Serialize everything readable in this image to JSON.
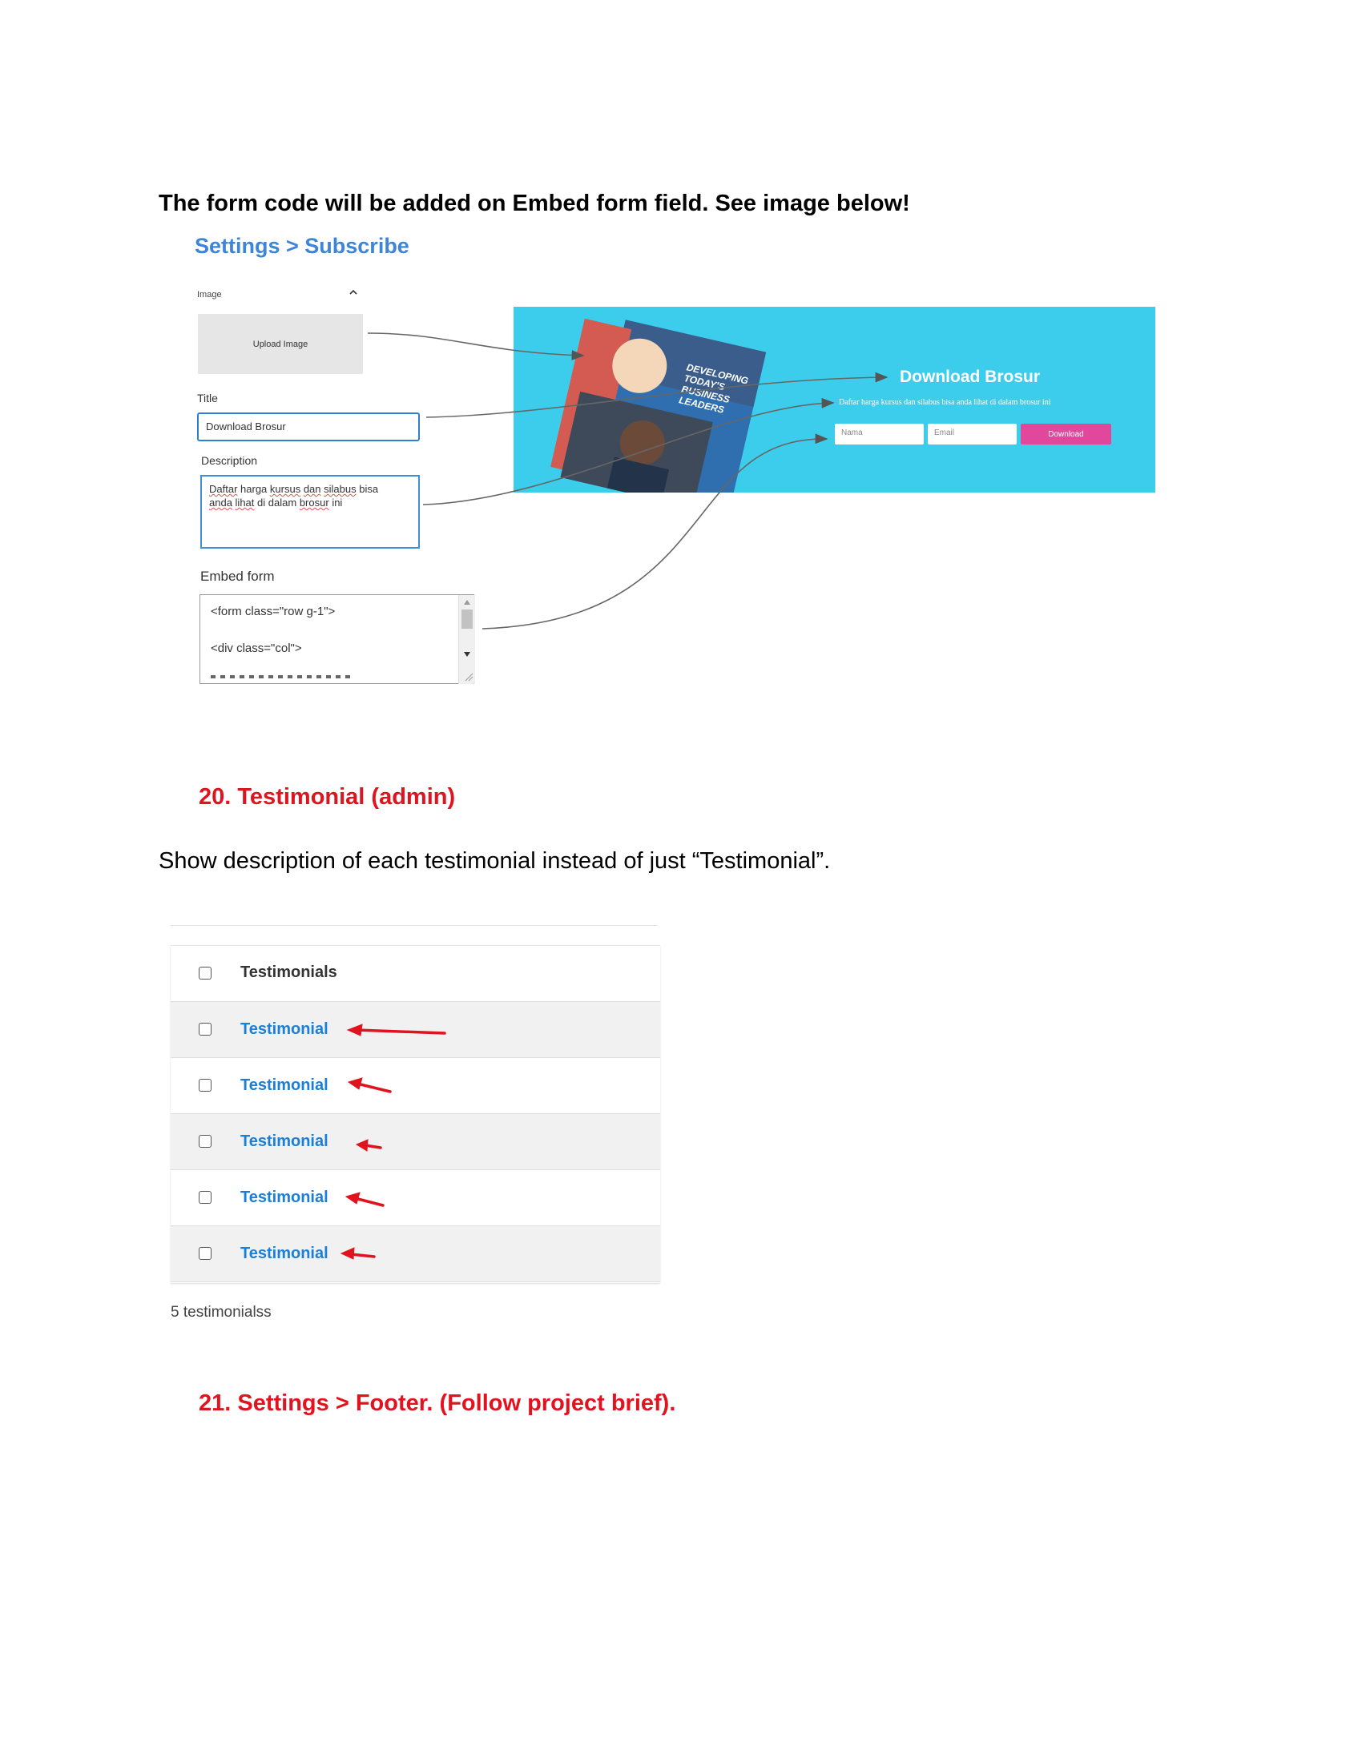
{
  "intro_text": "The form code will be added on Embed form field. See image below!",
  "settings_panel": {
    "title": "Settings > Subscribe",
    "image_label": "Image",
    "upload_button": "Upload Image",
    "title_label": "Title",
    "title_value": "Download Brosur",
    "description_label": "Description",
    "description_words": [
      "Daftar",
      "harga",
      "kursus",
      "dan",
      "silabus",
      "bisa",
      "anda",
      "lihat",
      "di",
      "dalam",
      "brosur",
      "ini"
    ],
    "embed_label": "Embed form",
    "embed_lines": [
      "<form class=\"row g-1\">",
      "<div class=\"col\">"
    ]
  },
  "preview_banner": {
    "brochure_heading": "DEVELOPING TODAY'S BUSINESS LEADERS",
    "title": "Download Brosur",
    "description": "Daftar harga kursus dan silabus bisa anda lihat di dalam brosur ini",
    "name_placeholder": "Nama",
    "email_placeholder": "Email",
    "button_label": "Download",
    "colors": {
      "background": "#3dcdec",
      "button": "#e1489c"
    }
  },
  "section_20": {
    "heading": "20. Testimonial (admin)",
    "body": "Show description of each testimonial instead of just “Testimonial”."
  },
  "testimonial_list": {
    "header": "Testimonials",
    "rows": [
      "Testimonial",
      "Testimonial",
      "Testimonial",
      "Testimonial",
      "Testimonial"
    ],
    "count": "5 testimonialss"
  },
  "section_21": {
    "heading": "21. Settings > Footer. (Follow project brief)."
  }
}
